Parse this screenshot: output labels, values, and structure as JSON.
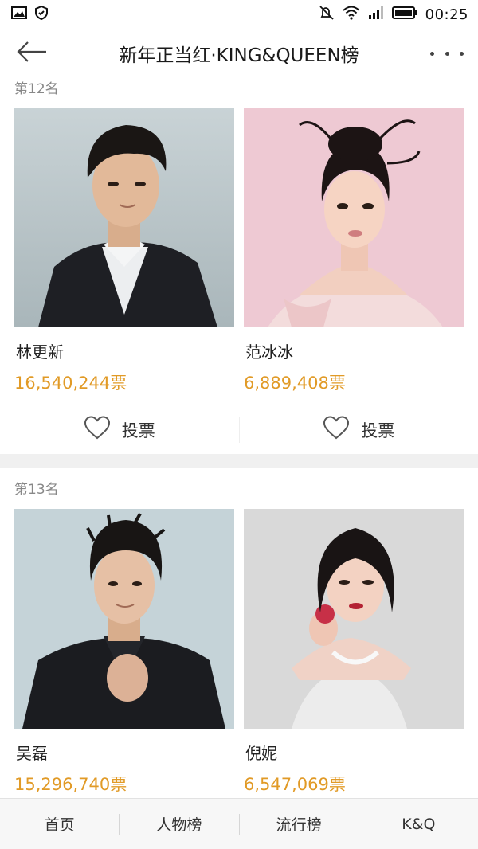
{
  "status_bar": {
    "time": "00:25"
  },
  "header": {
    "title": "新年正当红·KING&QUEEN榜"
  },
  "rankings": [
    {
      "rank_label": "第12名",
      "entries": [
        {
          "name": "林更新",
          "votes": "16,540,244票"
        },
        {
          "name": "范冰冰",
          "votes": "6,889,408票"
        }
      ],
      "vote_label": "投票"
    },
    {
      "rank_label": "第13名",
      "entries": [
        {
          "name": "吴磊",
          "votes": "15,296,740票"
        },
        {
          "name": "倪妮",
          "votes": "6,547,069票"
        }
      ]
    }
  ],
  "bottom_nav": {
    "items": [
      "首页",
      "人物榜",
      "流行榜",
      "K&Q"
    ]
  },
  "colors": {
    "votes": "#e19a26",
    "section_gap": "#f0f0f0"
  }
}
